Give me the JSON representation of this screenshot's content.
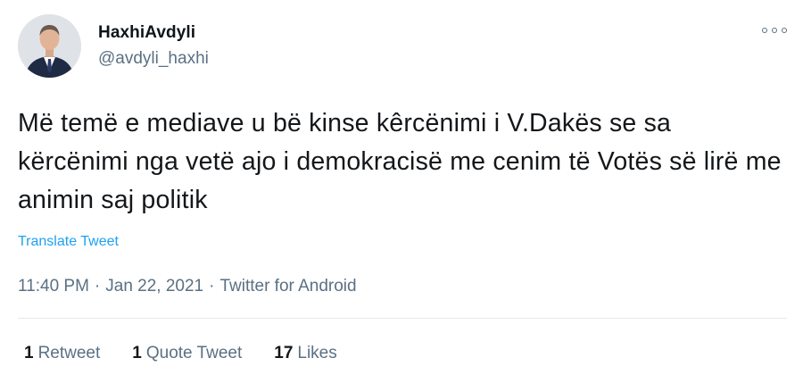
{
  "author": {
    "display_name": "HaxhiAvdyli",
    "handle": "@avdyli_haxhi",
    "avatar_icon": "profile-photo"
  },
  "tweet": {
    "text": "Më temë e mediave u bë kinse kêrcënimi i V.Dakës se sa kërcënimi nga vetë ajo i demokracisë me cenim të Votës së lirë me animin saj politik",
    "translate_label": "Translate Tweet",
    "time": "11:40 PM",
    "separator1": "·",
    "date": "Jan 22, 2021",
    "separator2": "·",
    "source": "Twitter for Android"
  },
  "stats": {
    "retweets_count": "1",
    "retweets_label": "Retweet",
    "quotes_count": "1",
    "quotes_label": "Quote Tweet",
    "likes_count": "17",
    "likes_label": "Likes"
  },
  "colors": {
    "link": "#1da1f2",
    "secondary": "#5b7083",
    "text": "#14171a",
    "divider": "#e1e8ed"
  }
}
